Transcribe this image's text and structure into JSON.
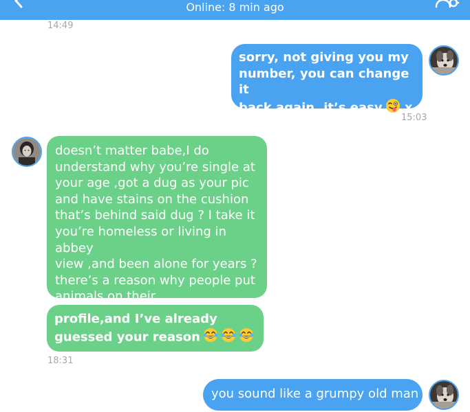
{
  "header": {
    "status": "Online: 8 min ago",
    "color": "#4aa3f0"
  },
  "icons": {
    "back": "chevron-left-icon",
    "settings": "user-settings-icon",
    "face_tongue": "winking-face-with-tongue-icon",
    "laughing": "face-with-tears-of-joy-icon"
  },
  "colors": {
    "sent_bubble": "#4aa3f0",
    "received_bubble": "#6bd188",
    "timestamp": "#a7a7a7"
  },
  "messages": [
    {
      "timestamp": "14:49"
    },
    {
      "direction": "sent",
      "text": "sorry, not giving you my\nnumber, you can change it\nback again, it’s easy",
      "suffix": "x",
      "timestamp": "15:03"
    },
    {
      "direction": "received",
      "text": "doesn’t matter babe,I do\nunderstand why you’re single at\nyour age ,got a dug as your pic\nand have stains on the cushion\nthat’s behind said dug ? I take it\nyou’re homeless or living in abbey\nview ,and been alone for years ?\nthere’s a reason why people put\nanimals on their"
    },
    {
      "direction": "received",
      "text": "profile,and I’ve already\nguessed your reason",
      "timestamp": "18:31"
    },
    {
      "direction": "sent",
      "text": "you sound like a grumpy old man"
    }
  ]
}
